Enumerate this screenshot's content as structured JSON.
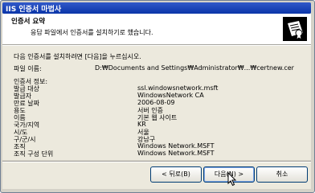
{
  "window": {
    "title": "IIS 인증서 마법사"
  },
  "header": {
    "title": "인증서 요약",
    "subtitle": "응답 파일에서 인증서를 설치하기로 했습니다."
  },
  "content": {
    "instruction": "다음 인증서를 설치하려면 [다음]을 누르십시오.",
    "file_label": "파일 이름:",
    "file_value": "D:₩Documents and Settings₩Administrator₩...₩certnew.cer",
    "info_label": "인증서 정보:",
    "rows": [
      {
        "label": "발급 대상",
        "value": "ssl.windowsnetwork.msft"
      },
      {
        "label": "발급자",
        "value": "WindowsNetwork CA"
      },
      {
        "label": "만료 날짜",
        "value": "2006-08-09"
      },
      {
        "label": "용도",
        "value": "서버 인증"
      },
      {
        "label": "이름",
        "value": "기본 웹 사이트"
      },
      {
        "label": "국가/지역",
        "value": "KR"
      },
      {
        "label": "시/도",
        "value": "서울"
      },
      {
        "label": "구/군/시",
        "value": "강남구"
      },
      {
        "label": "조직",
        "value": "Windows Network.MSFT"
      },
      {
        "label": "조직 구성 단위",
        "value": "Windows Network.MSFT"
      }
    ]
  },
  "buttons": {
    "back": "< 뒤로(B)",
    "next": "다음(N) >",
    "cancel": "취소"
  },
  "colors": {
    "title_bar": "#0a35a9",
    "dialog_bg": "#ece9dd",
    "header_bg": "#ffffff"
  }
}
